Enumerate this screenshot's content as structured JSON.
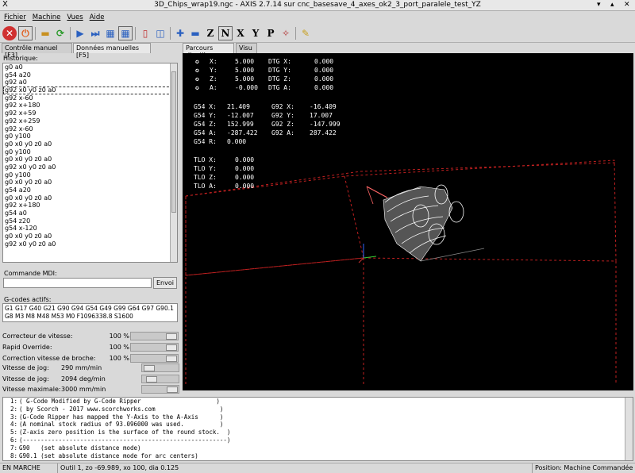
{
  "window": {
    "title": "3D_Chips_wrap19.ngc - AXIS 2.7.14 sur cnc_basesave_4_axes_ok2_3_port_paralele_test_YZ",
    "x_glyph": "X"
  },
  "menu": [
    "Fichier",
    "Machine",
    "Vues",
    "Aide"
  ],
  "left_tabs": [
    "Contrôle manuel [F3]",
    "Données manuelles [F5]"
  ],
  "right_tabs": [
    "Parcours d'outil",
    "Visu"
  ],
  "history": {
    "label": "Historique:",
    "items": [
      "g0 a0",
      "g54 a20",
      "g92 a0",
      "g92 x0 y0 z0 a0",
      "g92 x-60",
      "g92 x+180",
      "g92 x+59",
      "g92 x+259",
      "g92 x-60",
      "g0 y100",
      "g0 x0 y0 z0 a0",
      "g0 y100",
      "g0 x0 y0 z0 a0",
      "g92 x0 y0 z0 a0",
      "g0 y100",
      "g0 x0 y0 z0 a0",
      "g54 a20",
      "g0 x0 y0 z0 a0",
      "g92 x+180",
      "g54 a0",
      "g54 z20",
      "g54 x-120",
      "g0 x0 y0 z0 a0",
      "g92 x0 y0 z0 a0"
    ],
    "selected_index": 3
  },
  "mdi": {
    "label": "Commande MDI:",
    "value": "",
    "button": "Envoi"
  },
  "gcodes": {
    "label": "G-codes actifs:",
    "line1": "G1 G17 G40 G21 G90 G94 G54 G49 G99 G64 G97 G90.1",
    "line2": "G8 M3 M8 M48 M53 M0 F1096338.8 S1600"
  },
  "controls": [
    {
      "label": "Correcteur de vitesse:",
      "value": "100 %",
      "level": 1.0
    },
    {
      "label": "Rapid Override:",
      "value": "100 %",
      "level": 1.0
    },
    {
      "label": "Correction vitesse de broche:",
      "value": "100 %",
      "level": 1.0
    }
  ],
  "jogs": [
    {
      "label": "Vitesse de jog:",
      "value": "290 mm/min",
      "level": 0.08
    },
    {
      "label": "Vitesse de jog:",
      "value": "2094 deg/min",
      "level": 0.15
    },
    {
      "label": "Vitesse maximale:",
      "value": "3000 mm/min",
      "level": 1.0
    }
  ],
  "dro": {
    "block1": [
      {
        "axis": "X:",
        "val": "5.000",
        "dtg": "DTG X:",
        "dval": "0.000"
      },
      {
        "axis": "Y:",
        "val": "5.000",
        "dtg": "DTG Y:",
        "dval": "0.000"
      },
      {
        "axis": "Z:",
        "val": "5.000",
        "dtg": "DTG Z:",
        "dval": "0.000"
      },
      {
        "axis": "A:",
        "val": "-0.000",
        "dtg": "DTG A:",
        "dval": "0.000"
      }
    ],
    "block2": [
      {
        "l": "G54 X:",
        "v": "21.409",
        "r": "G92 X:",
        "rv": "-16.409"
      },
      {
        "l": "G54 Y:",
        "v": "-12.007",
        "r": "G92 Y:",
        "rv": "17.007"
      },
      {
        "l": "G54 Z:",
        "v": "152.999",
        "r": "G92 Z:",
        "rv": "-147.999"
      },
      {
        "l": "G54 A:",
        "v": "-287.422",
        "r": "G92 A:",
        "rv": "287.422"
      },
      {
        "l": "G54 R:",
        "v": "0.000",
        "r": "",
        "rv": ""
      }
    ],
    "block3": [
      {
        "l": "TLO X:",
        "v": "0.000"
      },
      {
        "l": "TLO Y:",
        "v": "0.000"
      },
      {
        "l": "TLO Z:",
        "v": "0.000"
      },
      {
        "l": "TLO A:",
        "v": "0.000"
      }
    ]
  },
  "gcode_lines": [
    {
      "n": "1:",
      "t": "( G-Code Modified by G-Code Ripper                     )"
    },
    {
      "n": "2:",
      "t": "( by Scorch - 2017 www.scorchworks.com                  )"
    },
    {
      "n": "3:",
      "t": "(G-Code Ripper has mapped the Y-Axis to the A-Axis      )"
    },
    {
      "n": "4:",
      "t": "(A nominal stock radius of 93.096000 was used.          )"
    },
    {
      "n": "5:",
      "t": "(Z-axis zero position is the surface of the round stock.  )"
    },
    {
      "n": "6:",
      "t": "(---------------------------------------------------------)"
    },
    {
      "n": "7:",
      "t": "G90   (set absolute distance mode)"
    },
    {
      "n": "8:",
      "t": "G90.1 (set absolute distance mode for arc centers)"
    },
    {
      "n": "9:",
      "t": "G17   (set active plane to XY)"
    }
  ],
  "status": {
    "state": "EN MARCHE",
    "tool": "Outil 1, zo -69.989, xo 100, dia 0.125",
    "position": "Position: Machine Commandée"
  },
  "colors": {
    "boundary": "#e03030",
    "path": "#ffffff",
    "background": "#000000"
  }
}
